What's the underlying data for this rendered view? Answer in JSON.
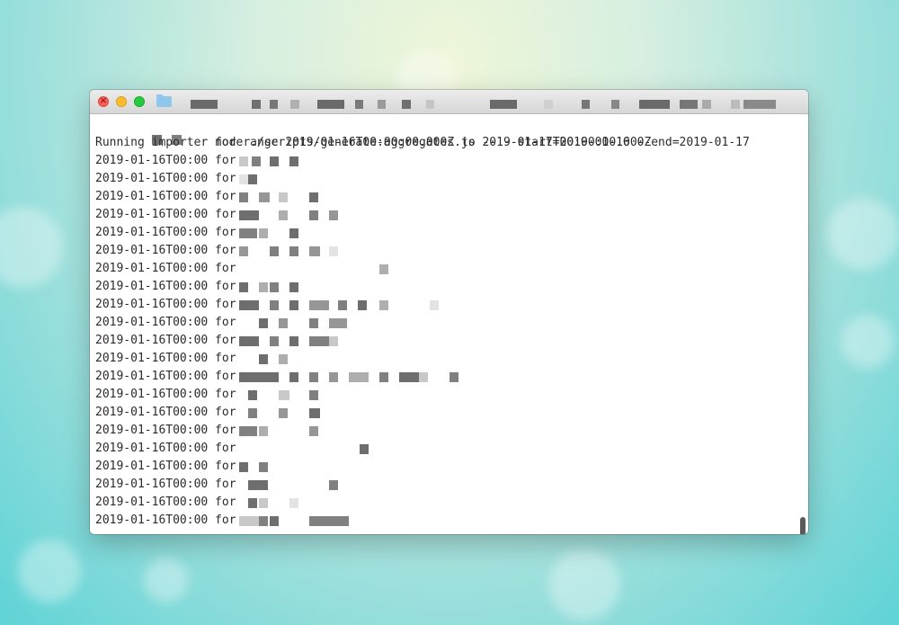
{
  "terminal": {
    "command": "node ./scripts/generate-aggregates.js -- --start=2019-01-16 --end=2019-01-17",
    "status_line": "Running importer for range 2019-01-16T00:00:00.000Z to 2019-01-17T00:00:00.000Z",
    "log_prefix": "2019-01-16T00:00 for",
    "log_line_count": 21
  },
  "icons": {
    "close": "close-icon",
    "minimize": "minimize-icon",
    "maximize": "maximize-icon",
    "folder": "folder-icon"
  },
  "colors": {
    "close": "#fc5f57",
    "minimize": "#fdbc2e",
    "maximize": "#28c840",
    "text": "#2b2b2b"
  }
}
